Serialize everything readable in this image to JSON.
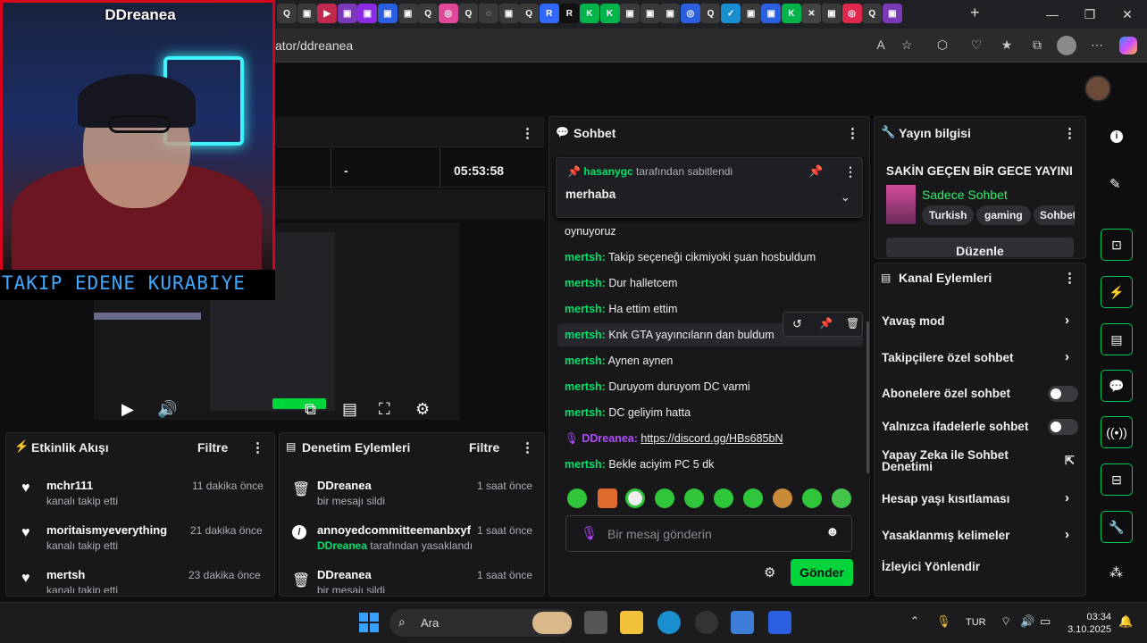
{
  "browser": {
    "url": "ator/ddreanea",
    "tab_icons": [
      "Q",
      "▣",
      "▶",
      "▣",
      "▣",
      "▣",
      "▣",
      "Q",
      "◎",
      "Q",
      "◌",
      "▣",
      "Q",
      "R",
      "R",
      "K",
      "K",
      "▣",
      "▣",
      "▣",
      "◎",
      "Q",
      "✓",
      "▣",
      "▣",
      "K",
      "✕",
      "▣",
      "◎",
      "Q",
      "▣"
    ],
    "new_tab": "+",
    "minimize": "—",
    "maximize": "❐",
    "close": "✕"
  },
  "webcam": {
    "title": "DDreanea",
    "banner": "TAKIP EDENE KURABIYE"
  },
  "stats": {
    "value_middle": "-",
    "uptime": "05:53:58"
  },
  "activity": {
    "title": "Etkinlik Akışı",
    "filter": "Filtre",
    "items": [
      {
        "user": "mchr111",
        "action": "kanalı takip etti",
        "time": "11 dakika önce"
      },
      {
        "user": "moritaismyeverything",
        "action": "kanalı takip etti",
        "time": "21 dakika önce"
      },
      {
        "user": "mertsh",
        "action": "kanalı takip etti",
        "time": "23 dakika önce"
      }
    ]
  },
  "moderation": {
    "title": "Denetim Eylemleri",
    "filter": "Filtre",
    "items": [
      {
        "user": "DDreanea",
        "action": "bir mesajı sildi",
        "time": "1 saat önce"
      },
      {
        "user": "annoyedcommitteemanbxyf",
        "by": "DDreanea",
        "action": "tarafından yasaklandı",
        "time": "1 saat önce"
      },
      {
        "user": "DDreanea",
        "action": "bir mesajı sildi",
        "time": "1 saat önce"
      }
    ]
  },
  "chat": {
    "title": "Sohbet",
    "pinned_by_user": "hasanygc",
    "pinned_by_suffix": "tarafından sabitlendi",
    "pinned_text": "merhaba",
    "messages": [
      {
        "user": "",
        "text": "oynuyoruz"
      },
      {
        "user": "mertsh:",
        "text": "Takip seçeneği cikmiyoki şuan hosbuldum"
      },
      {
        "user": "mertsh:",
        "text": "Dur halletcem"
      },
      {
        "user": "mertsh:",
        "text": "Ha ettim ettim"
      },
      {
        "user": "mertsh:",
        "text": "Knk GTA yayıncıların dan buldum"
      },
      {
        "user": "mertsh:",
        "text": "Aynen aynen"
      },
      {
        "user": "mertsh:",
        "text": "Duruyom duruyom DC varmi"
      },
      {
        "user": "mertsh:",
        "text": "DC geliyim hatta"
      },
      {
        "user": "DDreanea:",
        "text": "https://discord.gg/HBs685bN"
      },
      {
        "user": "mertsh:",
        "text": "Bekle aciyim PC 5 dk"
      }
    ],
    "placeholder": "Bir mesaj gönderin",
    "send": "Gönder"
  },
  "stream_info": {
    "title": "Yayın bilgisi",
    "stream_title": "SAKİN GEÇEN BİR GECE YAYINI",
    "category": "Sadece Sohbet",
    "tags": [
      "Turkish",
      "gaming",
      "Sohbet"
    ],
    "edit": "Düzenle"
  },
  "channel_actions": {
    "title": "Kanal Eylemleri",
    "rows": [
      {
        "label": "Yavaş mod",
        "kind": "chevron"
      },
      {
        "label": "Takipçilere özel sohbet",
        "kind": "chevron"
      },
      {
        "label": "Abonelere özel sohbet",
        "kind": "toggle"
      },
      {
        "label": "Yalnızca ifadelerle sohbet",
        "kind": "toggle"
      },
      {
        "label": "Yapay Zeka ile Sohbet Denetimi",
        "kind": "external"
      },
      {
        "label": "Hesap yaşı kısıtlaması",
        "kind": "chevron"
      },
      {
        "label": "Yasaklanmış kelimeler",
        "kind": "chevron"
      },
      {
        "label": "İzleyici Yönlendir",
        "kind": "none"
      }
    ]
  },
  "taskbar": {
    "search": "Ara",
    "lang": "TUR",
    "time": "03:34",
    "date": "3.10.2025"
  }
}
